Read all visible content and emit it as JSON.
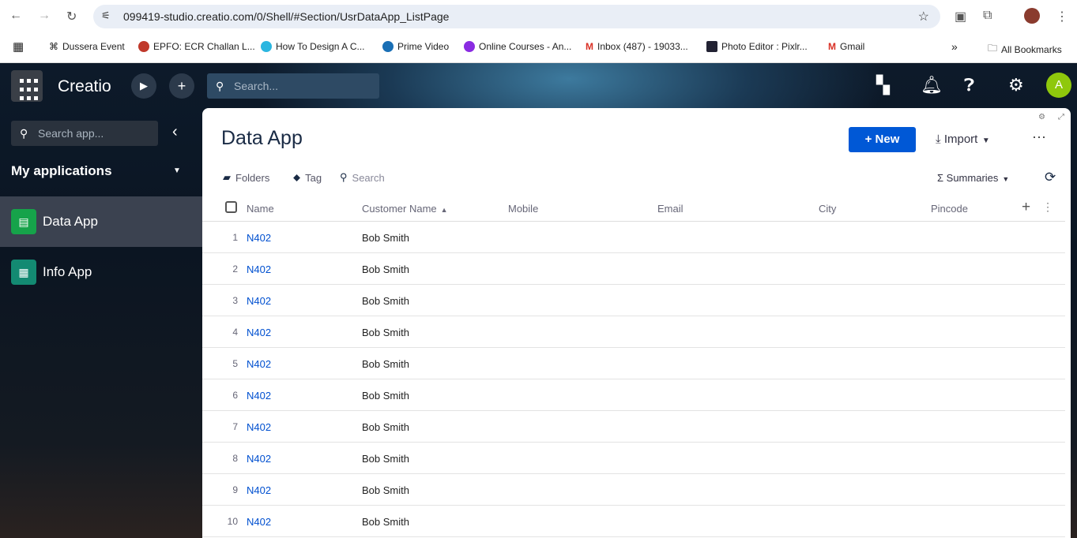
{
  "browser": {
    "url": "099419-studio.creatio.com/0/Shell/#Section/UsrDataApp_ListPage",
    "bookmarks": [
      "Dussera Event",
      "EPFO: ECR Challan L...",
      "How To Design A C...",
      "Prime Video",
      "Online Courses - An...",
      "Inbox (487) - 19033...",
      "Photo Editor : Pixlr...",
      "Gmail"
    ],
    "all_bookmarks": "All Bookmarks"
  },
  "topbar": {
    "logo": "Creatio",
    "search_placeholder": "Search...",
    "avatar": "A"
  },
  "sidebar": {
    "search_placeholder": "Search app...",
    "section": "My applications",
    "items": [
      {
        "label": "Data App",
        "active": true
      },
      {
        "label": "Info App",
        "active": false
      }
    ]
  },
  "page": {
    "title": "Data App",
    "new_label": "New",
    "import_label": "Import",
    "folders": "Folders",
    "tag": "Tag",
    "search": "Search",
    "summaries": "Summaries",
    "columns": [
      "Name",
      "Customer Name",
      "Mobile",
      "Email",
      "City",
      "Pincode"
    ],
    "rows": [
      {
        "n": "1",
        "name": "N402",
        "customer": "Bob Smith"
      },
      {
        "n": "2",
        "name": "N402",
        "customer": "Bob Smith"
      },
      {
        "n": "3",
        "name": "N402",
        "customer": "Bob Smith"
      },
      {
        "n": "4",
        "name": "N402",
        "customer": "Bob Smith"
      },
      {
        "n": "5",
        "name": "N402",
        "customer": "Bob Smith"
      },
      {
        "n": "6",
        "name": "N402",
        "customer": "Bob Smith"
      },
      {
        "n": "7",
        "name": "N402",
        "customer": "Bob Smith"
      },
      {
        "n": "8",
        "name": "N402",
        "customer": "Bob Smith"
      },
      {
        "n": "9",
        "name": "N402",
        "customer": "Bob Smith"
      },
      {
        "n": "10",
        "name": "N402",
        "customer": "Bob Smith"
      }
    ]
  },
  "colors": {
    "accent": "#0058d6",
    "avatar": "#8fc80c",
    "link": "#0050d0"
  }
}
